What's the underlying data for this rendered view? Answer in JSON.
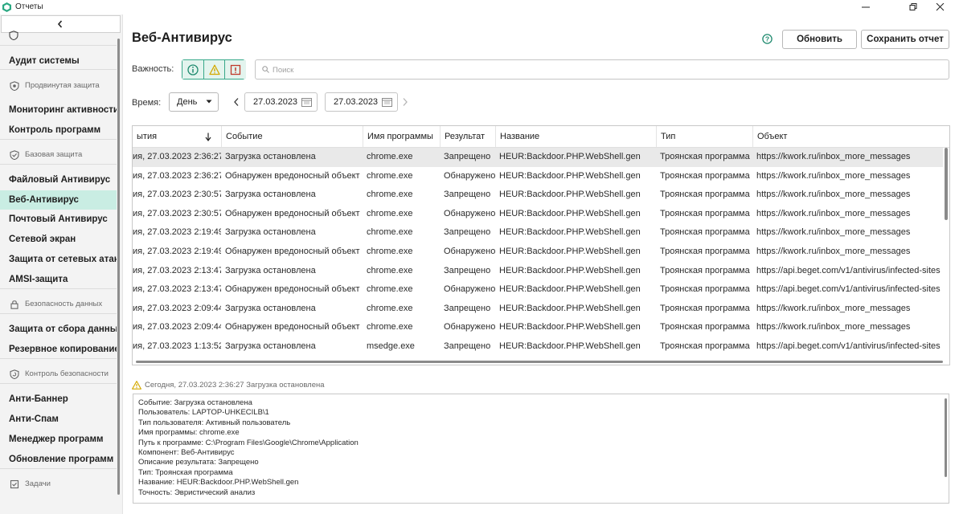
{
  "window": {
    "title": "Отчеты"
  },
  "sidebar": {
    "items": [
      {
        "kind": "icon",
        "icon": "shield-outline-icon"
      },
      {
        "kind": "item",
        "label": "Аудит системы"
      },
      {
        "kind": "group",
        "label": "Продвинутая защита",
        "icon": "shield-gear-icon"
      },
      {
        "kind": "item",
        "label": "Мониторинг активности"
      },
      {
        "kind": "item",
        "label": "Контроль программ"
      },
      {
        "kind": "group",
        "label": "Базовая защита",
        "icon": "shield-check-icon"
      },
      {
        "kind": "item",
        "label": "Файловый Антивирус"
      },
      {
        "kind": "item",
        "label": "Веб-Антивирус",
        "active": true
      },
      {
        "kind": "item",
        "label": "Почтовый Антивирус"
      },
      {
        "kind": "item",
        "label": "Сетевой экран"
      },
      {
        "kind": "item",
        "label": "Защита от сетевых атак"
      },
      {
        "kind": "item",
        "label": "AMSI-защита"
      },
      {
        "kind": "group",
        "label": "Безопасность данных",
        "icon": "lock-icon"
      },
      {
        "kind": "item",
        "label": "Защита от сбора данных"
      },
      {
        "kind": "item",
        "label": "Резервное копирование"
      },
      {
        "kind": "group",
        "label": "Контроль безопасности",
        "icon": "shield-sync-icon"
      },
      {
        "kind": "item",
        "label": "Анти-Баннер"
      },
      {
        "kind": "item",
        "label": "Анти-Спам"
      },
      {
        "kind": "item",
        "label": "Менеджер программ"
      },
      {
        "kind": "item",
        "label": "Обновление программ"
      },
      {
        "kind": "group",
        "label": "Задачи",
        "icon": "tasks-icon"
      }
    ]
  },
  "main": {
    "title": "Веб-Антивирус",
    "refresh_label": "Обновить",
    "save_label": "Сохранить отчет"
  },
  "filters": {
    "importance_label": "Важность:",
    "search_placeholder": "Поиск",
    "time_label": "Время:",
    "period": "День",
    "date_from": "27.03.2023",
    "date_to": "27.03.2023"
  },
  "table": {
    "columns": [
      "ытия",
      "Событие",
      "Имя программы",
      "Результат",
      "Название",
      "Тип",
      "Объект"
    ],
    "sort_column": "ытия",
    "rows": [
      [
        "ия, 27.03.2023 2:36:27",
        "Загрузка остановлена",
        "chrome.exe",
        "Запрещено",
        "HEUR:Backdoor.PHP.WebShell.gen",
        "Троянская программа",
        "https://kwork.ru/inbox_more_messages"
      ],
      [
        "ия, 27.03.2023 2:36:27",
        "Обнаружен вредоносный объект",
        "chrome.exe",
        "Обнаружено",
        "HEUR:Backdoor.PHP.WebShell.gen",
        "Троянская программа",
        "https://kwork.ru/inbox_more_messages"
      ],
      [
        "ия, 27.03.2023 2:30:57",
        "Загрузка остановлена",
        "chrome.exe",
        "Запрещено",
        "HEUR:Backdoor.PHP.WebShell.gen",
        "Троянская программа",
        "https://kwork.ru/inbox_more_messages"
      ],
      [
        "ия, 27.03.2023 2:30:57",
        "Обнаружен вредоносный объект",
        "chrome.exe",
        "Обнаружено",
        "HEUR:Backdoor.PHP.WebShell.gen",
        "Троянская программа",
        "https://kwork.ru/inbox_more_messages"
      ],
      [
        "ия, 27.03.2023 2:19:49",
        "Загрузка остановлена",
        "chrome.exe",
        "Запрещено",
        "HEUR:Backdoor.PHP.WebShell.gen",
        "Троянская программа",
        "https://kwork.ru/inbox_more_messages"
      ],
      [
        "ия, 27.03.2023 2:19:49",
        "Обнаружен вредоносный объект",
        "chrome.exe",
        "Обнаружено",
        "HEUR:Backdoor.PHP.WebShell.gen",
        "Троянская программа",
        "https://kwork.ru/inbox_more_messages"
      ],
      [
        "ия, 27.03.2023 2:13:47",
        "Загрузка остановлена",
        "chrome.exe",
        "Запрещено",
        "HEUR:Backdoor.PHP.WebShell.gen",
        "Троянская программа",
        "https://api.beget.com/v1/antivirus/infected-sites"
      ],
      [
        "ия, 27.03.2023 2:13:47",
        "Обнаружен вредоносный объект",
        "chrome.exe",
        "Обнаружено",
        "HEUR:Backdoor.PHP.WebShell.gen",
        "Троянская программа",
        "https://api.beget.com/v1/antivirus/infected-sites"
      ],
      [
        "ия, 27.03.2023 2:09:44",
        "Загрузка остановлена",
        "chrome.exe",
        "Запрещено",
        "HEUR:Backdoor.PHP.WebShell.gen",
        "Троянская программа",
        "https://kwork.ru/inbox_more_messages"
      ],
      [
        "ия, 27.03.2023 2:09:44",
        "Обнаружен вредоносный объект",
        "chrome.exe",
        "Обнаружено",
        "HEUR:Backdoor.PHP.WebShell.gen",
        "Троянская программа",
        "https://kwork.ru/inbox_more_messages"
      ],
      [
        "ия, 27.03.2023 1:13:52",
        "Загрузка остановлена",
        "msedge.exe",
        "Запрещено",
        "HEUR:Backdoor.PHP.WebShell.gen",
        "Троянская программа",
        "https://api.beget.com/v1/antivirus/infected-sites"
      ]
    ],
    "selected_row": 0
  },
  "detail": {
    "header": "Сегодня, 27.03.2023 2:36:27 Загрузка остановлена",
    "lines": [
      "Событие: Загрузка остановлена",
      "Пользователь: LAPTOP-UHKECILB\\1",
      "Тип пользователя: Активный пользователь",
      "Имя программы: chrome.exe",
      "Путь к программе: C:\\Program Files\\Google\\Chrome\\Application",
      "Компонент: Веб-Антивирус",
      "Описание результата: Запрещено",
      "Тип: Троянская программа",
      "Название: HEUR:Backdoor.PHP.WebShell.gen",
      "Точность: Эвристический анализ"
    ]
  },
  "colors": {
    "accent": "#37a889",
    "active_nav": "#c9ede3",
    "warning": "#e6b800",
    "danger": "#c0392b",
    "info": "#1e8a6e"
  }
}
